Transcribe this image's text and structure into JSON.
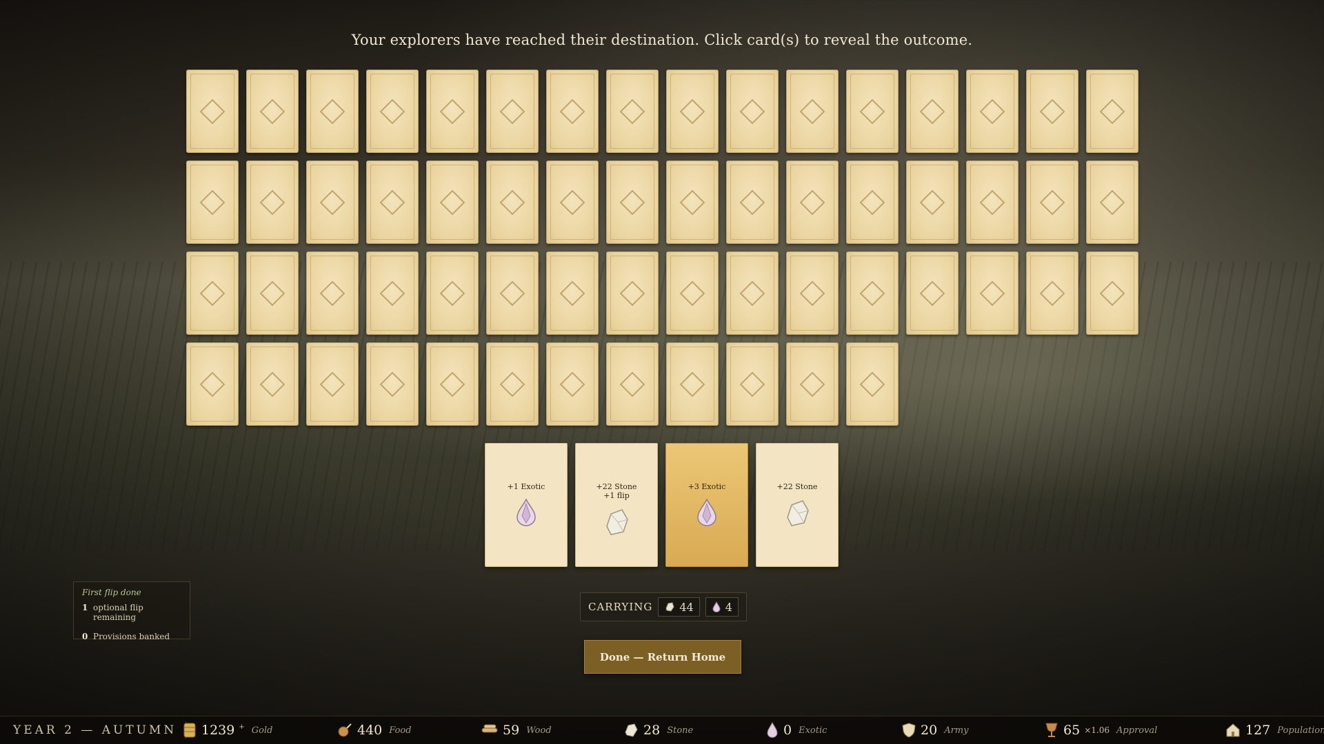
{
  "prompt": "Your explorers have reached their destination. Click card(s) to reveal the outcome.",
  "grid": {
    "hidden_card_count": 60
  },
  "revealed_cards": [
    {
      "label": "+1 Exotic",
      "icon": "exotic-gem-icon",
      "highlighted": false
    },
    {
      "label": "+22 Stone\n+1 flip",
      "icon": "stone-icon",
      "highlighted": false
    },
    {
      "label": "+3 Exotic",
      "icon": "exotic-gem-icon",
      "highlighted": true
    },
    {
      "label": "+22 Stone",
      "icon": "stone-icon",
      "highlighted": false
    }
  ],
  "carrying": {
    "label": "CARRYING",
    "stone": "44",
    "exotic": "4"
  },
  "done_button": "Done — Return Home",
  "status": {
    "header": "First flip done",
    "flips_remaining": "1",
    "flips_label": "optional flip remaining",
    "provisions": "0",
    "provisions_label": "Provisions banked"
  },
  "bottom_bar": {
    "season": "YEAR 2 — AUTUMN",
    "gold": {
      "value": "1239",
      "sup": "+",
      "name": "Gold"
    },
    "food": {
      "value": "440",
      "name": "Food"
    },
    "wood": {
      "value": "59",
      "name": "Wood"
    },
    "stone": {
      "value": "28",
      "name": "Stone"
    },
    "exotic": {
      "value": "0",
      "name": "Exotic"
    },
    "army": {
      "value": "20",
      "name": "Army"
    },
    "approval": {
      "value": "65",
      "modifier": "×1.06",
      "name": "Approval"
    },
    "population": {
      "value": "127",
      "name": "Population"
    }
  },
  "colors": {
    "card_back": "#ead49f",
    "highlight_card": "#d9aa53",
    "button": "#7b5f25"
  }
}
